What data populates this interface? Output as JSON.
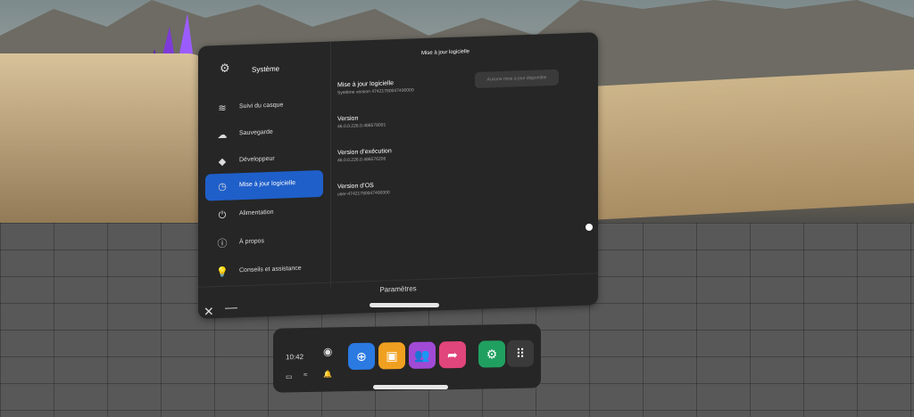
{
  "window": {
    "title": "Système",
    "footer_title": "Paramètres"
  },
  "sidebar": {
    "items": [
      {
        "label": "Suivi du casque",
        "icon": "sound-wave-icon"
      },
      {
        "label": "Sauvegarde",
        "icon": "cloud-icon"
      },
      {
        "label": "Développeur",
        "icon": "cube-icon"
      },
      {
        "label": "Mise à jour logicielle",
        "icon": "clock-icon",
        "active": true
      },
      {
        "label": "Alimentation",
        "icon": "power-icon"
      },
      {
        "label": "À propos",
        "icon": "info-icon"
      },
      {
        "label": "Conseils et assistance",
        "icon": "lightbulb-icon"
      }
    ]
  },
  "main": {
    "title": "Mise à jour logicielle",
    "update_button": "Aucune mise à jour disponible",
    "fields": [
      {
        "key": "Mise à jour logicielle",
        "value": "Système version 47421780047400000"
      },
      {
        "key": "Version",
        "value": "46.0.0.226.0.486578001"
      },
      {
        "key": "Version d’exécution",
        "value": "46.0.0.226.0.486576206"
      },
      {
        "key": "Version d’OS",
        "value": "user-47421780047400000"
      }
    ]
  },
  "dock": {
    "time": "10:42"
  }
}
